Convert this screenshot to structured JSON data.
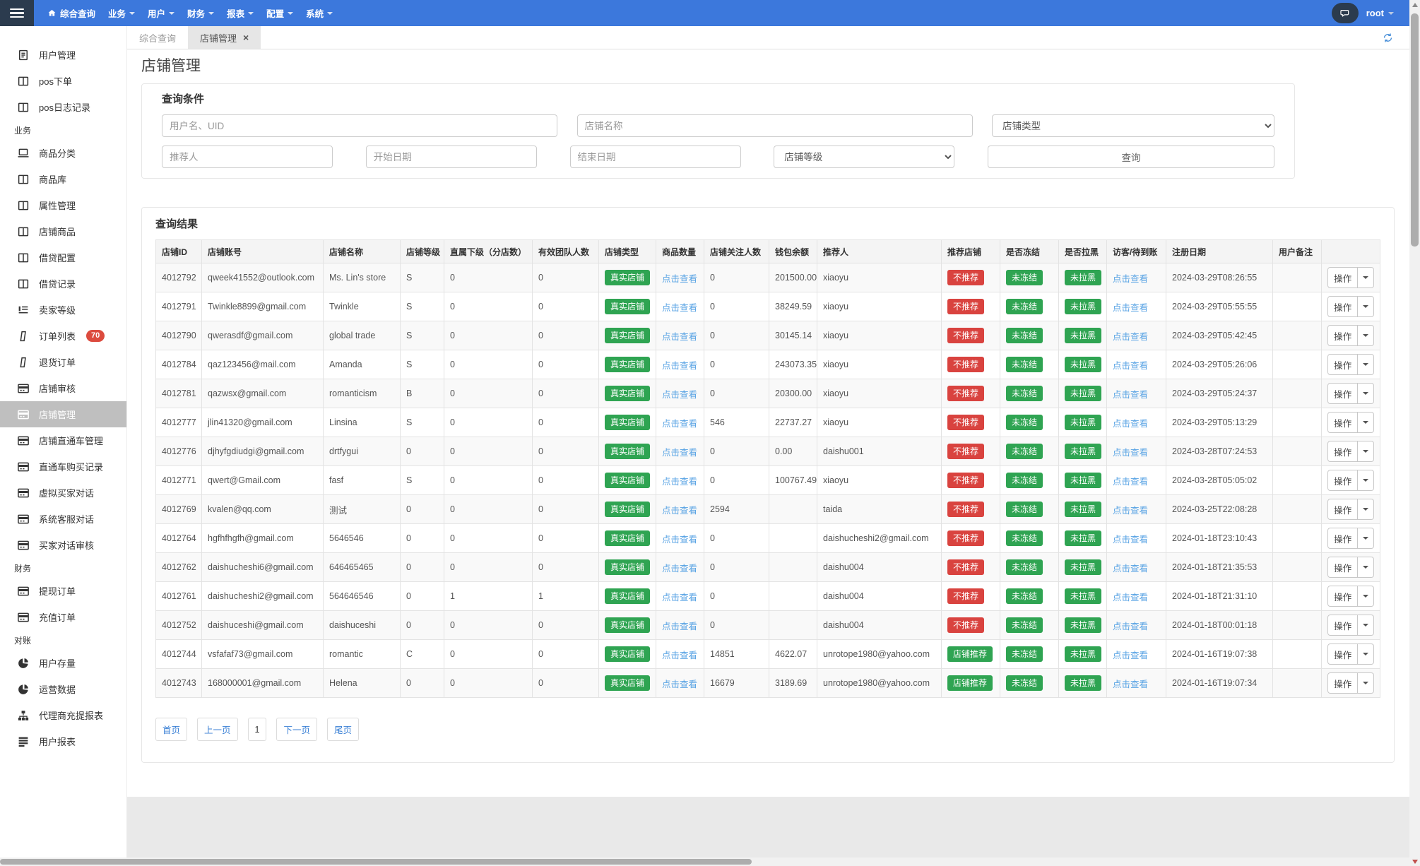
{
  "colors": {
    "navbar_blue": "#3c78dc",
    "navbar_dark": "#2b3b4e",
    "badge_green": "#2fa452",
    "badge_red": "#d9433f",
    "link_blue": "#58a3e4",
    "active_sidebar_bg": "#bfbfbf"
  },
  "navbar": {
    "menu": [
      {
        "key": "overview-query",
        "label": "综合查询",
        "icon": "home",
        "caret": false
      },
      {
        "key": "business",
        "label": "业务",
        "caret": true
      },
      {
        "key": "user",
        "label": "用户",
        "caret": true
      },
      {
        "key": "finance",
        "label": "财务",
        "caret": true
      },
      {
        "key": "report",
        "label": "报表",
        "caret": true
      },
      {
        "key": "config",
        "label": "配置",
        "caret": true
      },
      {
        "key": "system",
        "label": "系统",
        "caret": true
      }
    ],
    "user": "root"
  },
  "sidebar": {
    "items": [
      {
        "type": "item",
        "key": "user-management",
        "label": "用户管理",
        "icon": "file-text"
      },
      {
        "type": "item",
        "key": "pos-order",
        "label": "pos下单",
        "icon": "columns"
      },
      {
        "type": "item",
        "key": "pos-log",
        "label": "pos日志记录",
        "icon": "columns"
      },
      {
        "type": "header",
        "key": "business",
        "label": "业务"
      },
      {
        "type": "item",
        "key": "goods-category",
        "label": "商品分类",
        "icon": "laptop"
      },
      {
        "type": "item",
        "key": "goods-library",
        "label": "商品库",
        "icon": "columns"
      },
      {
        "type": "item",
        "key": "attribute-management",
        "label": "属性管理",
        "icon": "columns"
      },
      {
        "type": "item",
        "key": "shop-goods",
        "label": "店铺商品",
        "icon": "columns"
      },
      {
        "type": "item",
        "key": "loan-config",
        "label": "借贷配置",
        "icon": "columns"
      },
      {
        "type": "item",
        "key": "loan-records",
        "label": "借贷记录",
        "icon": "columns"
      },
      {
        "type": "item",
        "key": "seller-level",
        "label": "卖家等级",
        "icon": "list"
      },
      {
        "type": "item",
        "key": "order-list",
        "label": "订单列表",
        "icon": "file",
        "badge": "70"
      },
      {
        "type": "item",
        "key": "return-orders",
        "label": "退货订单",
        "icon": "file"
      },
      {
        "type": "item",
        "key": "shop-review",
        "label": "店铺审核",
        "icon": "card"
      },
      {
        "type": "item",
        "key": "shop-management",
        "label": "店铺管理",
        "icon": "card",
        "active": true
      },
      {
        "type": "item",
        "key": "shop-train-management",
        "label": "店铺直通车管理",
        "icon": "card"
      },
      {
        "type": "item",
        "key": "train-purchase-records",
        "label": "直通车购买记录",
        "icon": "card"
      },
      {
        "type": "item",
        "key": "virtual-buyer-chat",
        "label": "虚拟买家对话",
        "icon": "card"
      },
      {
        "type": "item",
        "key": "system-service-chat",
        "label": "系统客服对话",
        "icon": "card"
      },
      {
        "type": "item",
        "key": "buyer-chat-review",
        "label": "买家对话审核",
        "icon": "card"
      },
      {
        "type": "header",
        "key": "finance",
        "label": "财务"
      },
      {
        "type": "item",
        "key": "withdraw-orders",
        "label": "提现订单",
        "icon": "card"
      },
      {
        "type": "item",
        "key": "recharge-orders",
        "label": "充值订单",
        "icon": "card"
      },
      {
        "type": "header",
        "key": "reconciliation",
        "label": "对账"
      },
      {
        "type": "item",
        "key": "user-stock",
        "label": "用户存量",
        "icon": "pie"
      },
      {
        "type": "item",
        "key": "operation-data",
        "label": "运营数据",
        "icon": "pie"
      },
      {
        "type": "item",
        "key": "agent-recharge-report",
        "label": "代理商充提报表",
        "icon": "sitemap"
      },
      {
        "type": "item",
        "key": "user-report",
        "label": "用户报表",
        "icon": "lines"
      }
    ]
  },
  "tabs": [
    {
      "key": "overview-query",
      "label": "综合查询",
      "active": false,
      "closable": false
    },
    {
      "key": "shop-management",
      "label": "店铺管理",
      "active": true,
      "closable": true
    }
  ],
  "page_title": "店铺管理",
  "query_panel": {
    "title": "查询条件",
    "row1": [
      {
        "kind": "input",
        "key": "username-uid",
        "placeholder": "用户名、UID"
      },
      {
        "kind": "input",
        "key": "shop-name",
        "placeholder": "店铺名称"
      },
      {
        "kind": "select",
        "key": "shop-type",
        "value": "店铺类型"
      }
    ],
    "row2": [
      {
        "kind": "input",
        "key": "referrer",
        "placeholder": "推荐人"
      },
      {
        "kind": "input",
        "key": "start-date",
        "placeholder": "开始日期"
      },
      {
        "kind": "input",
        "key": "end-date",
        "placeholder": "结束日期"
      },
      {
        "kind": "select",
        "key": "shop-level",
        "value": "店铺等级"
      },
      {
        "kind": "button",
        "key": "search",
        "label": "查询"
      }
    ]
  },
  "results_panel": {
    "title": "查询结果",
    "columns": [
      "店铺ID",
      "店铺账号",
      "店铺名称",
      "店铺等级",
      "直属下级（分店数）",
      "有效团队人数",
      "店铺类型",
      "商品数量",
      "店铺关注人数",
      "钱包余额",
      "推荐人",
      "推荐店铺",
      "是否冻结",
      "是否拉黑",
      "访客/待到账",
      "注册日期",
      "用户备注",
      ""
    ],
    "badges": {
      "shop_type": "真实店铺",
      "view_link": "点击查看",
      "not_recommended": "不推荐",
      "recommended": "店铺推荐",
      "not_frozen": "未冻结",
      "not_blacklisted": "未拉黑",
      "action": "操作"
    },
    "rows": [
      {
        "id": "4012792",
        "account": "qweek41552@outlook.com",
        "name": "Ms. Lin's store",
        "level": "S",
        "sub": "0",
        "team": "0",
        "followers": "0",
        "wallet": "201500.00",
        "referrer": "xiaoyu",
        "recommend": "不推荐",
        "date": "2024-03-29T08:26:55",
        "remark": ""
      },
      {
        "id": "4012791",
        "account": "Twinkle8899@gmail.com",
        "name": "Twinkle",
        "level": "S",
        "sub": "0",
        "team": "0",
        "followers": "0",
        "wallet": "38249.59",
        "referrer": "xiaoyu",
        "recommend": "不推荐",
        "date": "2024-03-29T05:55:55",
        "remark": ""
      },
      {
        "id": "4012790",
        "account": "qwerasdf@gmail.com",
        "name": "global trade",
        "level": "S",
        "sub": "0",
        "team": "0",
        "followers": "0",
        "wallet": "30145.14",
        "referrer": "xiaoyu",
        "recommend": "不推荐",
        "date": "2024-03-29T05:42:45",
        "remark": ""
      },
      {
        "id": "4012784",
        "account": "qaz123456@mail.com",
        "name": "Amanda",
        "level": "S",
        "sub": "0",
        "team": "0",
        "followers": "0",
        "wallet": "243073.35",
        "referrer": "xiaoyu",
        "recommend": "不推荐",
        "date": "2024-03-29T05:26:06",
        "remark": ""
      },
      {
        "id": "4012781",
        "account": "qazwsx@gmail.com",
        "name": "romanticism",
        "level": "B",
        "sub": "0",
        "team": "0",
        "followers": "0",
        "wallet": "20300.00",
        "referrer": "xiaoyu",
        "recommend": "不推荐",
        "date": "2024-03-29T05:24:37",
        "remark": ""
      },
      {
        "id": "4012777",
        "account": "jlin41320@gmail.com",
        "name": "Linsina",
        "level": "S",
        "sub": "0",
        "team": "0",
        "followers": "546",
        "wallet": "22737.27",
        "referrer": "xiaoyu",
        "recommend": "不推荐",
        "date": "2024-03-29T05:13:29",
        "remark": ""
      },
      {
        "id": "4012776",
        "account": "djhyfgdiudgi@gmail.com",
        "name": "drtfygui",
        "level": "0",
        "sub": "0",
        "team": "0",
        "followers": "0",
        "wallet": "0.00",
        "referrer": "daishu001",
        "recommend": "不推荐",
        "date": "2024-03-28T07:24:53",
        "remark": ""
      },
      {
        "id": "4012771",
        "account": "qwert@Gmail.com",
        "name": "fasf",
        "level": "S",
        "sub": "0",
        "team": "0",
        "followers": "0",
        "wallet": "100767.49",
        "referrer": "xiaoyu",
        "recommend": "不推荐",
        "date": "2024-03-28T05:05:02",
        "remark": ""
      },
      {
        "id": "4012769",
        "account": "kvalen@qq.com",
        "name": "测试",
        "level": "0",
        "sub": "0",
        "team": "0",
        "followers": "2594",
        "wallet": "",
        "referrer": "taida",
        "recommend": "不推荐",
        "date": "2024-03-25T22:08:28",
        "remark": ""
      },
      {
        "id": "4012764",
        "account": "hgfhfhgfh@gmail.com",
        "name": "5646546",
        "level": "0",
        "sub": "0",
        "team": "0",
        "followers": "0",
        "wallet": "",
        "referrer": "daishucheshi2@gmail.com",
        "recommend": "不推荐",
        "date": "2024-01-18T23:10:43",
        "remark": ""
      },
      {
        "id": "4012762",
        "account": "daishucheshi6@gmail.com",
        "name": "646465465",
        "level": "0",
        "sub": "0",
        "team": "0",
        "followers": "0",
        "wallet": "",
        "referrer": "daishu004",
        "recommend": "不推荐",
        "date": "2024-01-18T21:35:53",
        "remark": ""
      },
      {
        "id": "4012761",
        "account": "daishucheshi2@gmail.com",
        "name": "564646546",
        "level": "0",
        "sub": "1",
        "team": "1",
        "followers": "0",
        "wallet": "",
        "referrer": "daishu004",
        "recommend": "不推荐",
        "date": "2024-01-18T21:31:10",
        "remark": ""
      },
      {
        "id": "4012752",
        "account": "daishuceshi@gmail.com",
        "name": "daishuceshi",
        "level": "0",
        "sub": "0",
        "team": "0",
        "followers": "0",
        "wallet": "",
        "referrer": "daishu004",
        "recommend": "不推荐",
        "date": "2024-01-18T00:01:18",
        "remark": ""
      },
      {
        "id": "4012744",
        "account": "vsfafaf73@gmail.com",
        "name": "romantic",
        "level": "C",
        "sub": "0",
        "team": "0",
        "followers": "14851",
        "wallet": "4622.07",
        "referrer": "unrotope1980@yahoo.com",
        "recommend": "店铺推荐",
        "date": "2024-01-16T19:07:38",
        "remark": ""
      },
      {
        "id": "4012743",
        "account": "168000001@gmail.com",
        "name": "Helena",
        "level": "0",
        "sub": "0",
        "team": "0",
        "followers": "16679",
        "wallet": "3189.69",
        "referrer": "unrotope1980@yahoo.com",
        "recommend": "店铺推荐",
        "date": "2024-01-16T19:07:34",
        "remark": ""
      }
    ],
    "pagination": [
      {
        "key": "first",
        "label": "首页"
      },
      {
        "key": "prev",
        "label": "上一页"
      },
      {
        "key": "page-1",
        "label": "1",
        "current": true
      },
      {
        "key": "next",
        "label": "下一页"
      },
      {
        "key": "last",
        "label": "尾页"
      }
    ]
  }
}
